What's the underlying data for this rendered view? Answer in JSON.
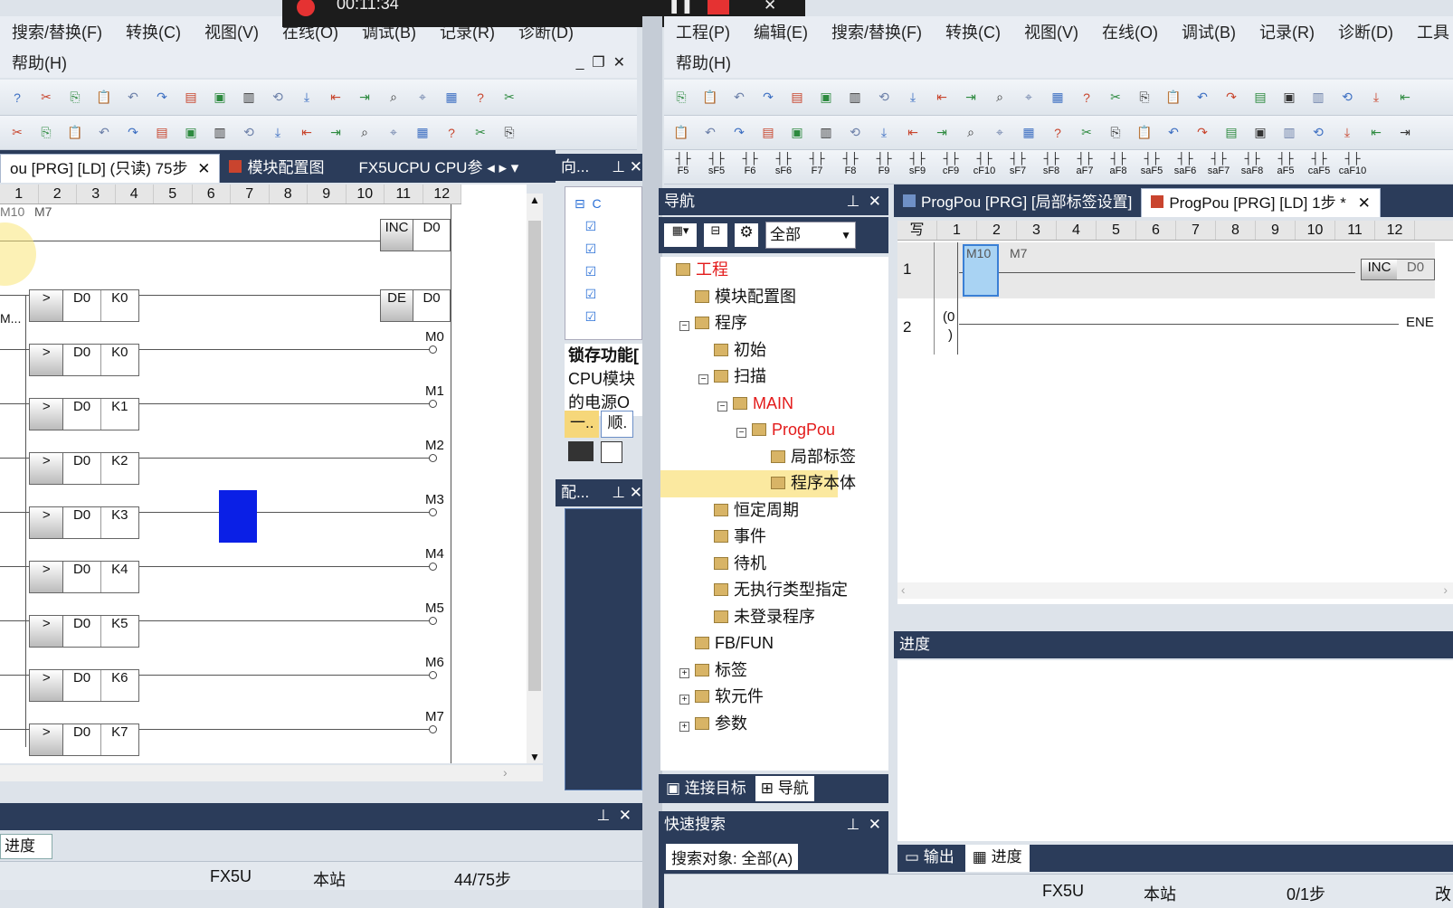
{
  "recorder": {
    "time": "00:11:34"
  },
  "left": {
    "menu_row1": [
      "搜索/替换(F)",
      "转换(C)",
      "视图(V)",
      "在线(O)",
      "调试(B)",
      "记录(R)",
      "诊断(D)"
    ],
    "menu_row2": [
      "帮助(H)"
    ],
    "tabs": [
      "ou [PRG] [LD] (只读) 75步",
      "模块配置图",
      "FX5UCPU CPU参"
    ],
    "ruler": [
      "1",
      "2",
      "3",
      "4",
      "5",
      "6",
      "7",
      "8",
      "9",
      "10",
      "11",
      "12"
    ],
    "contact_labels": [
      "M10",
      "M7",
      "M..."
    ],
    "rungs": [
      {
        "op": ">",
        "a": "D0",
        "b": "K0",
        "out": "DE",
        "out_arg": "D0"
      },
      {
        "op": ">",
        "a": "D0",
        "b": "K0",
        "out": "M0"
      },
      {
        "op": ">",
        "a": "D0",
        "b": "K1",
        "out": "M1"
      },
      {
        "op": ">",
        "a": "D0",
        "b": "K2",
        "out": "M2"
      },
      {
        "op": ">",
        "a": "D0",
        "b": "K3",
        "out": "M3"
      },
      {
        "op": ">",
        "a": "D0",
        "b": "K4",
        "out": "M4"
      },
      {
        "op": ">",
        "a": "D0",
        "b": "K5",
        "out": "M5"
      },
      {
        "op": ">",
        "a": "D0",
        "b": "K6",
        "out": "M6"
      },
      {
        "op": ">",
        "a": "D0",
        "b": "K7",
        "out": "M7"
      }
    ],
    "inc_box": {
      "op": "INC",
      "arg": "D0"
    },
    "side_panel": {
      "title": "向...",
      "lock_title": "锁存功能[",
      "lock_text1": "CPU模块",
      "lock_text2": "的电源O",
      "btn1": "一..",
      "btn2": "顺."
    },
    "config_panel_title": "配...",
    "progress_tab": "进度",
    "status": {
      "cpu": "FX5U",
      "station": "本站",
      "steps": "44/75步"
    }
  },
  "right": {
    "menu_row1": [
      "工程(P)",
      "编辑(E)",
      "搜索/替换(F)",
      "转换(C)",
      "视图(V)",
      "在线(O)",
      "调试(B)",
      "记录(R)",
      "诊断(D)",
      "工具"
    ],
    "menu_row2": [
      "帮助(H)"
    ],
    "fkeys": [
      "F5",
      "sF5",
      "F6",
      "sF6",
      "F7",
      "F8",
      "F9",
      "sF9",
      "cF9",
      "cF10",
      "sF7",
      "sF8",
      "aF7",
      "aF8",
      "saF5",
      "saF6",
      "saF7",
      "saF8",
      "aF5",
      "caF5",
      "caF10"
    ],
    "nav": {
      "title": "导航",
      "filter": "全部",
      "items": [
        {
          "label": "工程",
          "level": 0,
          "red": true
        },
        {
          "label": "模块配置图",
          "level": 1
        },
        {
          "label": "程序",
          "level": 1,
          "expand": "−"
        },
        {
          "label": "初始",
          "level": 2
        },
        {
          "label": "扫描",
          "level": 2,
          "expand": "−"
        },
        {
          "label": "MAIN",
          "level": 3,
          "expand": "−",
          "red": true
        },
        {
          "label": "ProgPou",
          "level": 4,
          "expand": "−",
          "red": true
        },
        {
          "label": "局部标签",
          "level": 5
        },
        {
          "label": "程序本体",
          "level": 5,
          "selected": true
        },
        {
          "label": "恒定周期",
          "level": 2
        },
        {
          "label": "事件",
          "level": 2
        },
        {
          "label": "待机",
          "level": 2
        },
        {
          "label": "无执行类型指定",
          "level": 2
        },
        {
          "label": "未登录程序",
          "level": 2
        },
        {
          "label": "FB/FUN",
          "level": 1
        },
        {
          "label": "标签",
          "level": 1,
          "expand": "+"
        },
        {
          "label": "软元件",
          "level": 1,
          "expand": "+"
        },
        {
          "label": "参数",
          "level": 1,
          "expand": "+"
        }
      ],
      "bottom_tabs": [
        "连接目标",
        "导航"
      ]
    },
    "quick_search": {
      "title": "快速搜索",
      "target": "搜索对象: 全部(A)"
    },
    "editor_tabs": [
      "ProgPou [PRG] [局部标签设置]",
      "ProgPou [PRG] [LD] 1步 *"
    ],
    "ruler": [
      "写",
      "1",
      "2",
      "3",
      "4",
      "5",
      "6",
      "7",
      "8",
      "9",
      "10",
      "11",
      "12"
    ],
    "row1": {
      "num": "1",
      "c1": "M10",
      "c2": "M7",
      "op": "INC",
      "arg": "D0"
    },
    "row2": {
      "num": "2",
      "step": "(0",
      "step2": ")",
      "end": "ENE"
    },
    "progress_title": "进度",
    "output_tabs": [
      "输出",
      "进度"
    ],
    "status": {
      "cpu": "FX5U",
      "station": "本站",
      "steps": "0/1步",
      "mode": "改"
    }
  }
}
